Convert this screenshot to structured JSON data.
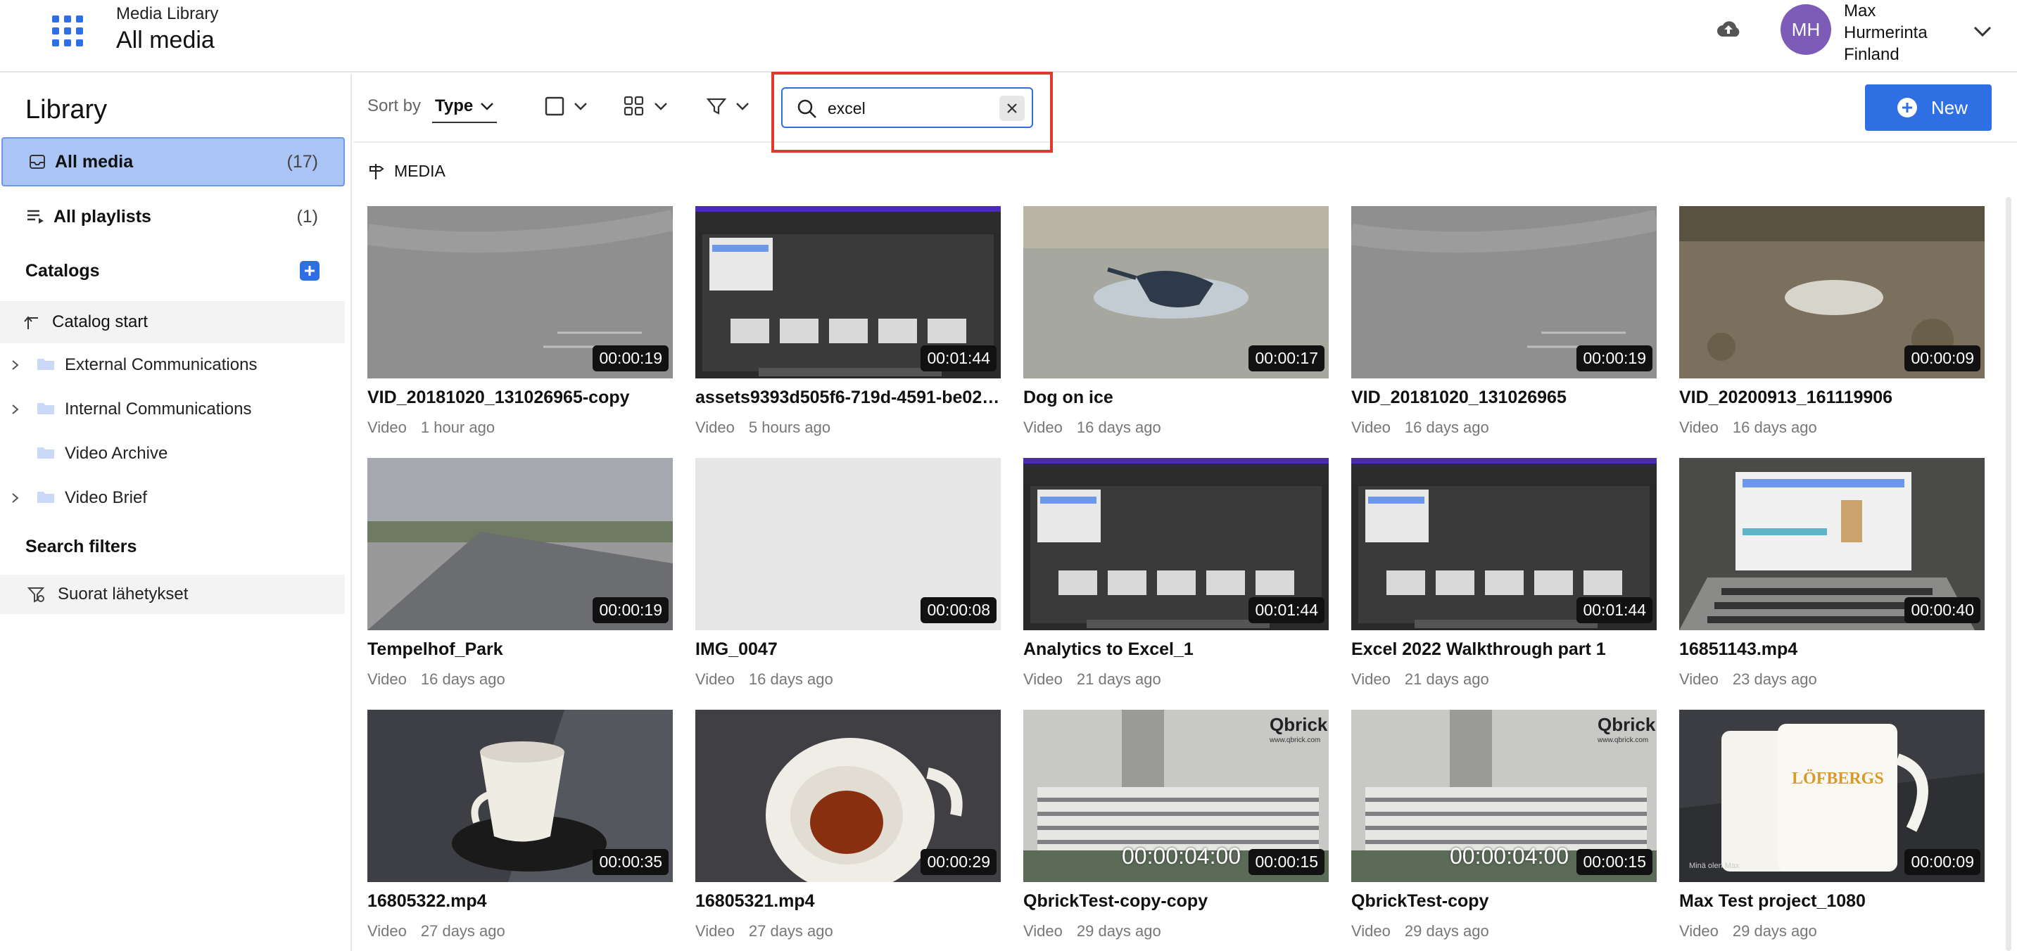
{
  "header": {
    "app_subtitle": "Media Library",
    "page_title": "All media",
    "user_initials": "MH",
    "user_line1": "Max",
    "user_line2": "Hurmerinta",
    "user_line3": "Finland",
    "avatar_color": "#7d5bb8"
  },
  "sidebar": {
    "title": "Library",
    "all_media": {
      "label": "All media",
      "count": "(17)"
    },
    "all_playlists": {
      "label": "All playlists",
      "count": "(1)"
    },
    "catalogs_heading": "Catalogs",
    "catalog_start": "Catalog start",
    "catalogs": [
      {
        "label": "External Communications",
        "expandable": true
      },
      {
        "label": "Internal Communications",
        "expandable": true
      },
      {
        "label": "Video Archive",
        "expandable": false
      },
      {
        "label": "Video Brief",
        "expandable": true
      }
    ],
    "search_filters_heading": "Search filters",
    "saved_filters": [
      {
        "label": "Suorat lähetykset"
      }
    ]
  },
  "toolbar": {
    "sort_by_label": "Sort by",
    "sort_value": "Type",
    "search_value": "excel",
    "new_label": "New",
    "accent_color": "#2f6fe4",
    "highlight_color": "#e03a2a"
  },
  "content": {
    "section_label": "MEDIA",
    "items": [
      {
        "title": "VID_20181020_131026965-copy",
        "type": "Video",
        "age": "1 hour ago",
        "duration": "00:00:19",
        "thumb": "pavement"
      },
      {
        "title": "assets9393d505f6-719d-4591-be02-e...",
        "type": "Video",
        "age": "5 hours ago",
        "duration": "00:01:44",
        "thumb": "screen"
      },
      {
        "title": "Dog on ice",
        "type": "Video",
        "age": "16 days ago",
        "duration": "00:00:17",
        "thumb": "dog"
      },
      {
        "title": "VID_20181020_131026965",
        "type": "Video",
        "age": "16 days ago",
        "duration": "00:00:19",
        "thumb": "pavement"
      },
      {
        "title": "VID_20200913_161119906",
        "type": "Video",
        "age": "16 days ago",
        "duration": "00:00:09",
        "thumb": "ground"
      },
      {
        "title": "Tempelhof_Park",
        "type": "Video",
        "age": "16 days ago",
        "duration": "00:00:19",
        "thumb": "park"
      },
      {
        "title": "IMG_0047",
        "type": "Video",
        "age": "16 days ago",
        "duration": "00:00:08",
        "thumb": "blank"
      },
      {
        "title": "Analytics to Excel_1",
        "type": "Video",
        "age": "21 days ago",
        "duration": "00:01:44",
        "thumb": "screen"
      },
      {
        "title": "Excel 2022 Walkthrough part 1",
        "type": "Video",
        "age": "21 days ago",
        "duration": "00:01:44",
        "thumb": "screen"
      },
      {
        "title": "16851143.mp4",
        "type": "Video",
        "age": "23 days ago",
        "duration": "00:00:40",
        "thumb": "laptop"
      },
      {
        "title": "16805322.mp4",
        "type": "Video",
        "age": "27 days ago",
        "duration": "00:00:35",
        "thumb": "cup"
      },
      {
        "title": "16805321.mp4",
        "type": "Video",
        "age": "27 days ago",
        "duration": "00:00:29",
        "thumb": "cup-coffee"
      },
      {
        "title": "QbrickTest-copy-copy",
        "type": "Video",
        "age": "29 days ago",
        "duration": "00:00:15",
        "thumb": "building",
        "overlay": "00:00:04:00",
        "logo": "Qbrick"
      },
      {
        "title": "QbrickTest-copy",
        "type": "Video",
        "age": "29 days ago",
        "duration": "00:00:15",
        "thumb": "building",
        "overlay": "00:00:04:00",
        "logo": "Qbrick"
      },
      {
        "title": "Max Test project_1080",
        "type": "Video",
        "age": "29 days ago",
        "duration": "00:00:09",
        "thumb": "mugs",
        "logo": "LÖFBERGS"
      }
    ]
  }
}
